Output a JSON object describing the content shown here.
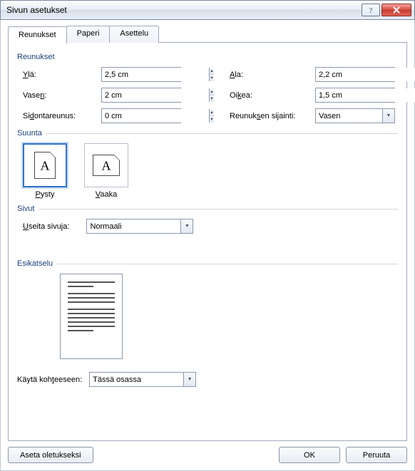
{
  "window": {
    "title": "Sivun asetukset"
  },
  "tabs": {
    "margins": "Reunukset",
    "paper": "Paperi",
    "layout": "Asettelu"
  },
  "margins_group": "Reunukset",
  "margins": {
    "top_label": "Ylä:",
    "top_value": "2,5 cm",
    "bottom_label": "Ala:",
    "bottom_value": "2,2 cm",
    "left_label": "Vasen:",
    "left_value": "2 cm",
    "right_label": "Oikea:",
    "right_value": "1,5 cm",
    "gutter_label": "Sidontareunus:",
    "gutter_value": "0 cm",
    "gutter_pos_label": "Reunuksen sijainti:",
    "gutter_pos_value": "Vasen"
  },
  "orientation": {
    "group": "Suunta",
    "portrait": "Pysty",
    "landscape": "Vaaka",
    "glyph": "A"
  },
  "pages": {
    "group": "Sivut",
    "label": "Useita sivuja:",
    "value": "Normaali"
  },
  "preview": {
    "group": "Esikatselu"
  },
  "apply": {
    "label": "Käytä kohteeseen:",
    "value": "Tässä osassa"
  },
  "footer": {
    "default": "Aseta oletukseksi",
    "ok": "OK",
    "cancel": "Peruuta"
  }
}
